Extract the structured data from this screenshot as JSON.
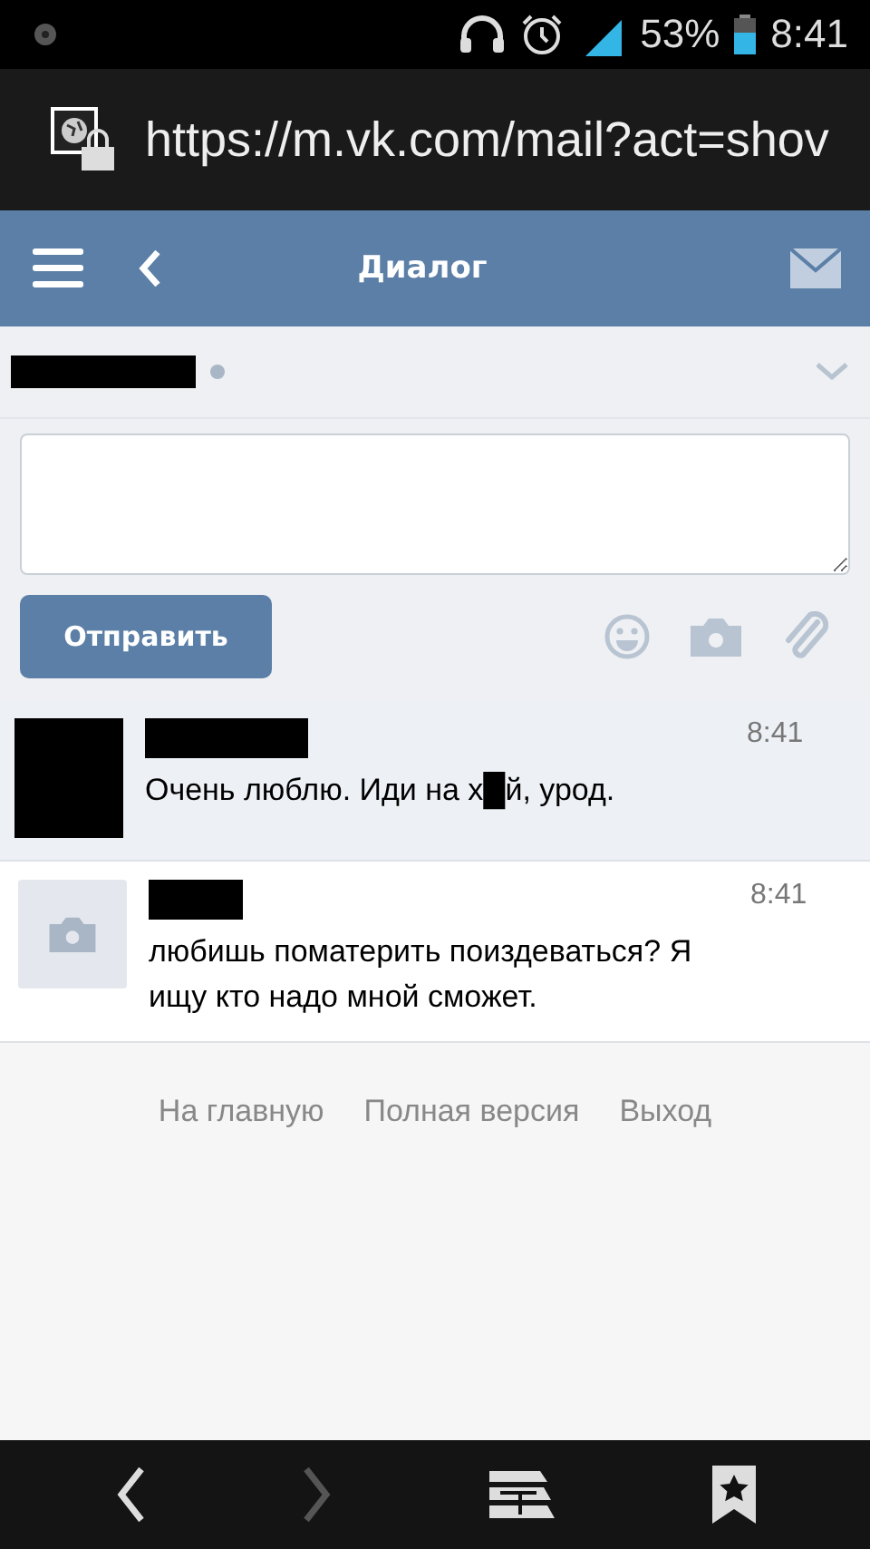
{
  "status_bar": {
    "battery": "53%",
    "time": "8:41"
  },
  "browser": {
    "url": "https://m.vk.com/mail?act=shov"
  },
  "header": {
    "title": "Диалог"
  },
  "compose": {
    "send_button": "Отправить"
  },
  "messages": [
    {
      "kind": "redacted",
      "unread": true,
      "time": "8:41",
      "text": "Очень люблю. Иди на х█й, урод."
    },
    {
      "kind": "placeholder",
      "unread": false,
      "time": "8:41",
      "text": "любишь поматерить поиздеваться? Я ищу кто надо мной сможет."
    }
  ],
  "footer_links": [
    "На главную",
    "Полная версия",
    "Выход"
  ],
  "nav": [
    {
      "kind": "back",
      "disabled": false
    },
    {
      "kind": "forward",
      "disabled": true
    },
    {
      "kind": "reader"
    },
    {
      "kind": "bookmarks"
    }
  ]
}
